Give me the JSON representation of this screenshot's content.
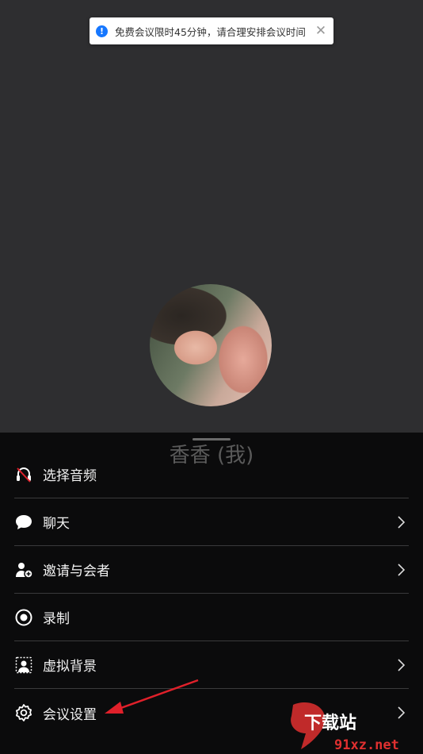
{
  "toast": {
    "message": "免费会议限时45分钟，请合理安排会议时间",
    "info_glyph": "!",
    "close_glyph": "✕"
  },
  "participant": {
    "name": "香香 (我)"
  },
  "menu": {
    "items": [
      {
        "label": "选择音频",
        "icon": "headset-muted-icon",
        "has_chevron": false
      },
      {
        "label": "聊天",
        "icon": "chat-bubble-icon",
        "has_chevron": true
      },
      {
        "label": "邀请与会者",
        "icon": "add-user-icon",
        "has_chevron": true
      },
      {
        "label": "录制",
        "icon": "record-icon",
        "has_chevron": false
      },
      {
        "label": "虚拟背景",
        "icon": "virtual-background-icon",
        "has_chevron": true
      },
      {
        "label": "会议设置",
        "icon": "gear-icon",
        "has_chevron": true
      }
    ]
  },
  "watermark": {
    "brand": "下载站",
    "domain": "91xz.net"
  },
  "colors": {
    "meeting_bg": "#2e2e30",
    "sheet_bg": "#0b0b0c",
    "toast_info": "#1677ff",
    "annotation_arrow": "#e0202a",
    "watermark_red": "#e03030"
  }
}
